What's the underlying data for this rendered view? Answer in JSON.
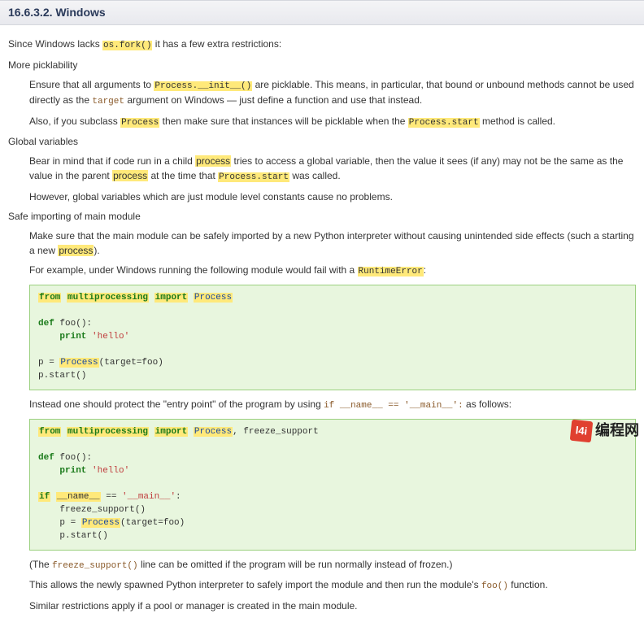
{
  "header": {
    "title": "16.6.3.2. Windows"
  },
  "intro": {
    "pre": "Since Windows lacks ",
    "code": "os.fork()",
    "post": " it has a few extra restrictions:"
  },
  "picklability": {
    "heading": "More picklability",
    "p1": {
      "a": "Ensure that all arguments to ",
      "code1": "Process.__init__()",
      "b": " are picklable. This means, in particular, that bound or unbound methods cannot be used directly as the ",
      "code2": "target",
      "c": " argument on Windows — just define a function and use that instead."
    },
    "p2": {
      "a": "Also, if you subclass ",
      "code1": "Process",
      "b": " then make sure that instances will be picklable when the ",
      "code2": "Process.start",
      "c": " method is called."
    }
  },
  "globals": {
    "heading": "Global variables",
    "p1": {
      "a": "Bear in mind that if code run in a child ",
      "hl1": "process",
      "b": " tries to access a global variable, then the value it sees (if any) may not be the same as the value in the parent ",
      "hl2": "process",
      "c": " at the time that ",
      "code": "Process.start",
      "d": " was called."
    },
    "p2": "However, global variables which are just module level constants cause no problems."
  },
  "safe": {
    "heading": "Safe importing of main module",
    "p1": {
      "a": "Make sure that the main module can be safely imported by a new Python interpreter without causing unintended side effects (such a starting a new ",
      "hl": "process",
      "b": ")."
    },
    "p2": {
      "a": "For example, under Windows running the following module would fail with a ",
      "code": "RuntimeError",
      "b": ":"
    },
    "p3": {
      "a": "Instead one should protect the \"entry point\" of the program by using ",
      "code": "if __name__ == '__main__':",
      "b": " as follows:"
    },
    "p4": {
      "a": "(The ",
      "code": "freeze_support()",
      "b": " line can be omitted if the program will be run normally instead of frozen.)"
    },
    "p5": {
      "a": "This allows the newly spawned Python interpreter to safely import the module and then run the module's ",
      "code": "foo()",
      "b": " function."
    },
    "p6": "Similar restrictions apply if a pool or manager is created in the main module."
  },
  "code1": {
    "l1_from": "from",
    "l1_mod": "multiprocessing",
    "l1_import": "import",
    "l1_cls": "Process",
    "l2_def": "def",
    "l2_name": " foo():",
    "l3_print": "    print",
    "l3_str": " 'hello'",
    "l4a": "p = ",
    "l4_cls": "Process",
    "l4b": "(target=foo)",
    "l5": "p.start()"
  },
  "code2": {
    "l1_from": "from",
    "l1_mod": "multiprocessing",
    "l1_import": "import",
    "l1_cls": "Process",
    "l1_rest": ", freeze_support",
    "l2_def": "def",
    "l2_name": " foo():",
    "l3_print": "    print",
    "l3_str": " 'hello'",
    "l4_if": "if",
    "l4_name": "__name__",
    "l4_eq": " == ",
    "l4_main": "'__main__'",
    "l4_colon": ":",
    "l5": "    freeze_support()",
    "l6a": "    p = ",
    "l6_cls": "Process",
    "l6b": "(target=foo)",
    "l7": "    p.start()"
  },
  "watermark": {
    "badge": "l4i",
    "text": "编程网"
  }
}
